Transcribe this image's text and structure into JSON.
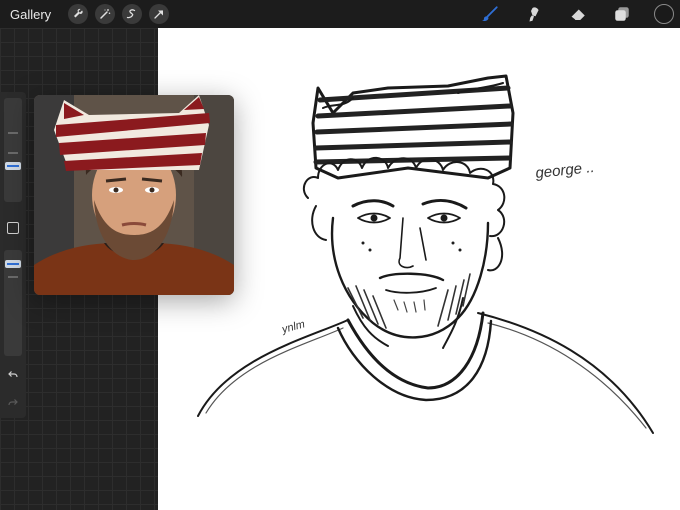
{
  "toolbar": {
    "gallery_label": "Gallery",
    "left_tools": [
      {
        "name": "wrench-icon"
      },
      {
        "name": "magic-wand-icon"
      },
      {
        "name": "selection-icon"
      },
      {
        "name": "transform-arrow-icon"
      }
    ],
    "right_tools": [
      {
        "name": "brush-icon",
        "active": true
      },
      {
        "name": "smudge-icon",
        "active": false
      },
      {
        "name": "eraser-icon",
        "active": false
      },
      {
        "name": "layers-icon",
        "active": false
      }
    ],
    "current_color": "#1a1a1a",
    "accent_color": "#2f6fd6"
  },
  "canvas": {
    "annotation_text": "george ..",
    "signature_text": "ynlm"
  },
  "colors": {
    "dark_background": "#222222",
    "canvas_background": "#ffffff",
    "toolbar_background": "#1c1c1c"
  }
}
